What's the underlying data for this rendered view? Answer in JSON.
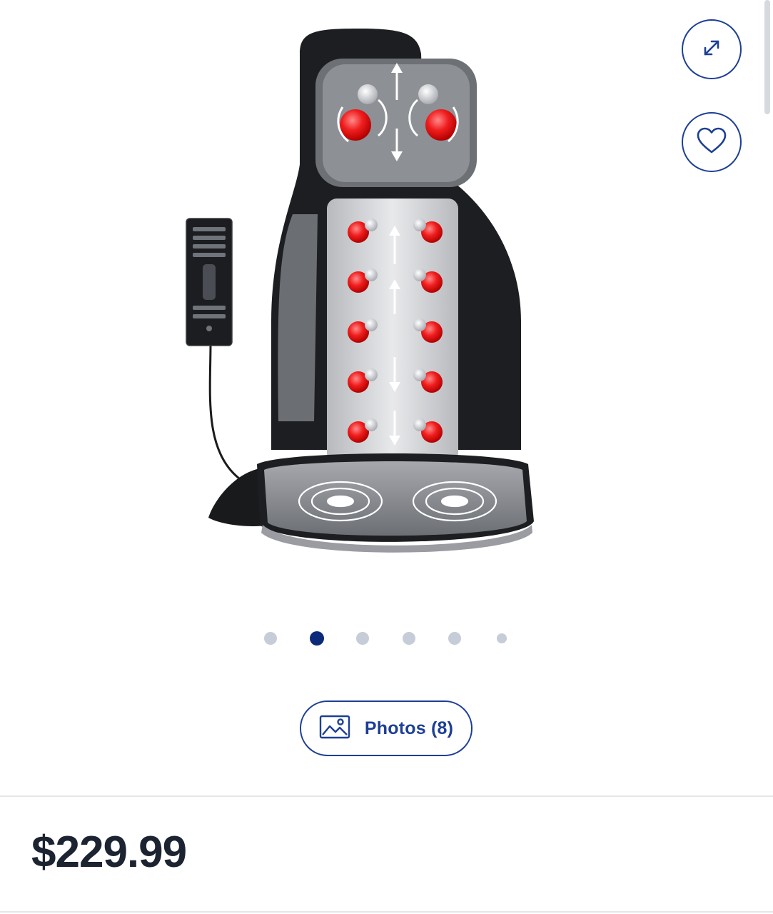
{
  "gallery": {
    "expand_icon": "expand-arrows-icon",
    "favorite_icon": "heart-icon",
    "product_image_alt": "Shiatsu massage seat cushion with remote",
    "dots": {
      "count": 6,
      "active_index": 1
    },
    "photos_button": {
      "label": "Photos (8)",
      "icon": "image-icon"
    }
  },
  "pricing": {
    "price": "$229.99"
  },
  "colors": {
    "accent": "#1d3f95",
    "dot_inactive": "#c6ccd8",
    "dot_active": "#0b2a7a",
    "price_text": "#1c2331"
  }
}
